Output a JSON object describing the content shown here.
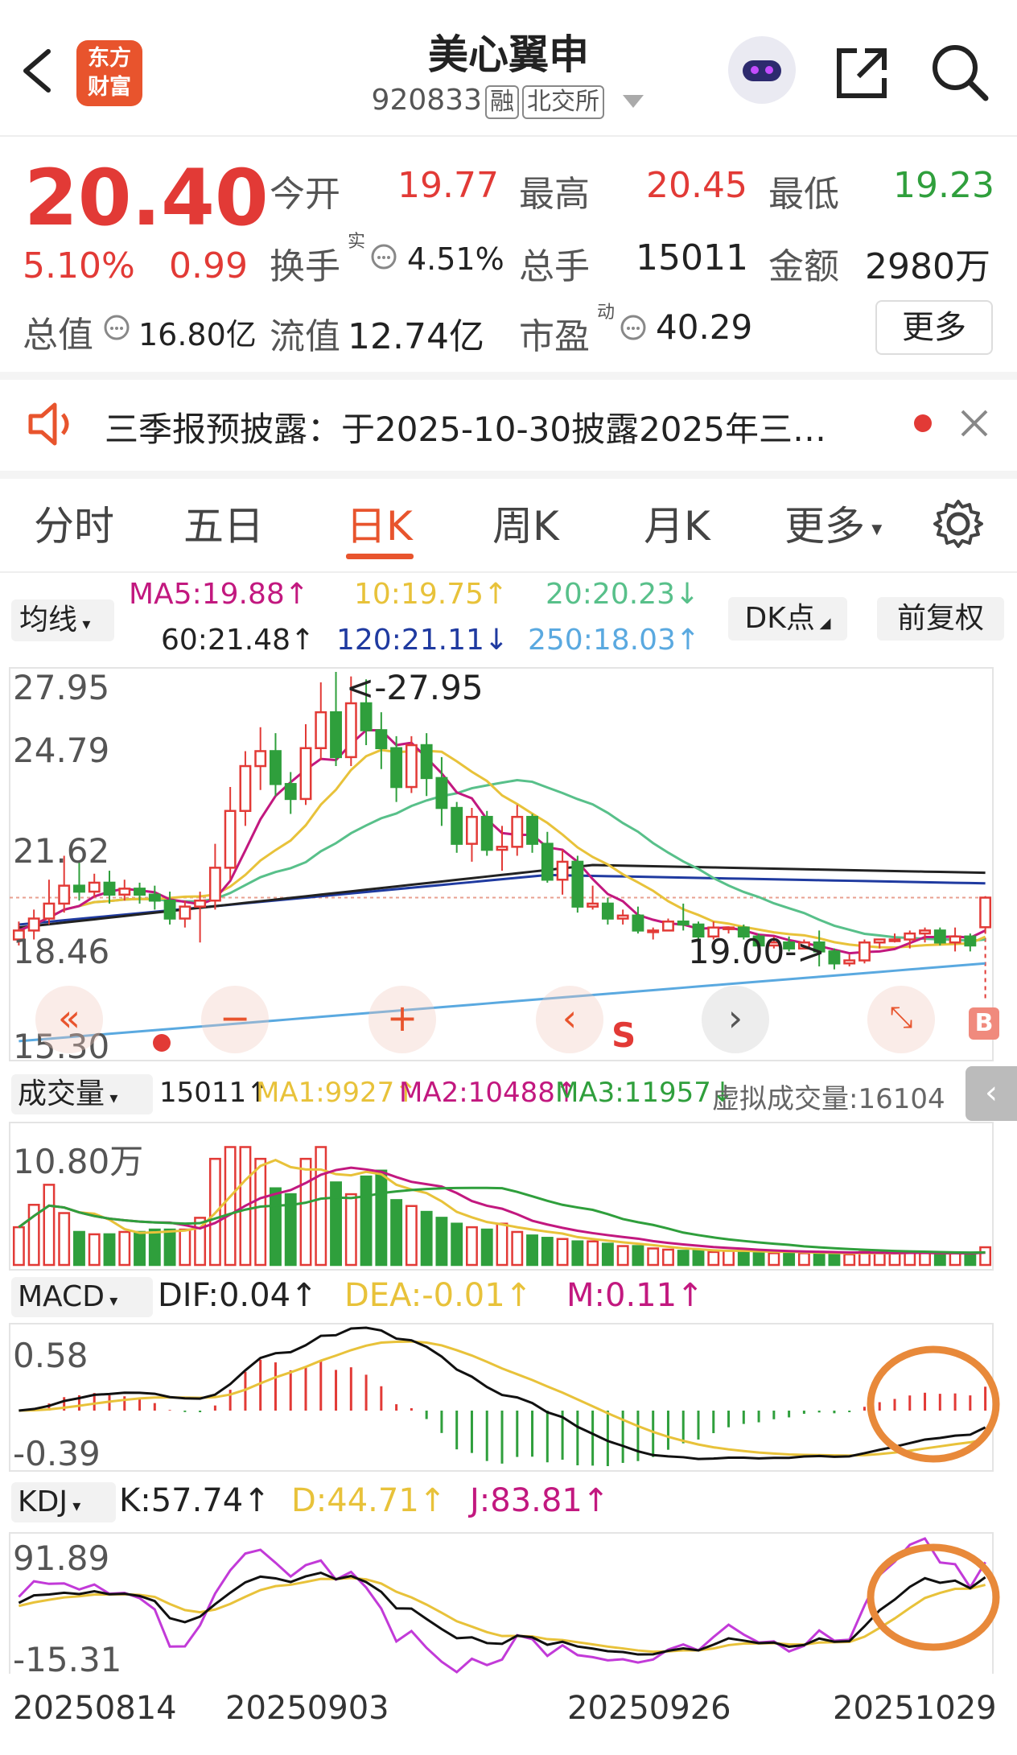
{
  "header": {
    "title": "美心翼申",
    "code": "920833",
    "tag_margin": "融",
    "tag_exchange": "北交所",
    "logo_line1": "东方",
    "logo_line2": "财富"
  },
  "quote": {
    "price": "20.40",
    "change_pct": "5.10%",
    "change_amt": "0.99",
    "open_label": "今开",
    "open": "19.77",
    "high_label": "最高",
    "high": "20.45",
    "low_label": "最低",
    "low": "19.23",
    "turnover_label": "换手",
    "turnover_sup": "实",
    "turnover": "4.51%",
    "volume_label": "总手",
    "volume": "15011",
    "amount_label": "金额",
    "amount": "2980万",
    "mktcap_label": "总值",
    "mktcap": "16.80亿",
    "float_label": "流值",
    "float_cap": "12.74亿",
    "pe_label": "市盈",
    "pe_sup": "动",
    "pe": "40.29",
    "more_label": "更多"
  },
  "notice": {
    "text": "三季报预披露：于2025-10-30披露2025年三…"
  },
  "tabs": [
    "分时",
    "五日",
    "日K",
    "周K",
    "月K",
    "更多"
  ],
  "selected_tab": "日K",
  "kline": {
    "ma_selector": "均线",
    "dk_label": "DK点",
    "adjust_label": "前复权",
    "ma5": "MA5:19.88↑",
    "ma10": "10:19.75↑",
    "ma20": "20:20.23↓",
    "ma60": "60:21.48↑",
    "ma120": "120:21.11↓",
    "ma250": "250:18.03↑",
    "y_labels": [
      "27.95",
      "24.79",
      "21.62",
      "18.46",
      "15.30"
    ],
    "high_note": "<-27.95",
    "low_note": "19.00->",
    "sell_mark": "S",
    "buy_mark": "B"
  },
  "volume_panel": {
    "selector": "成交量",
    "vol": "15011↑",
    "ma1": "MA1:9927↑",
    "ma2": "MA2:10488↑",
    "ma3": "MA3:11957↓",
    "virtual": "虚拟成交量:16104",
    "y_label": "10.80万"
  },
  "macd": {
    "selector": "MACD",
    "dif": "DIF:0.04↑",
    "dea": "DEA:-0.01↑",
    "m": "M:0.11↑",
    "y_top": "0.58",
    "y_bottom": "-0.39"
  },
  "kdj": {
    "selector": "KDJ",
    "k": "K:57.74↑",
    "d": "D:44.71↑",
    "j": "J:83.81↑",
    "y_top": "91.89",
    "y_bottom": "-15.31"
  },
  "dates": [
    "20250814",
    "20250903",
    "20250926",
    "20251029"
  ],
  "colors": {
    "up": "#e23a36",
    "down": "#2f9f3c",
    "accent": "#e8542d",
    "ma5": "#c2187f",
    "ma10": "#e8c23a",
    "ma20": "#58c08a",
    "ma60": "#222222",
    "ma120": "#1f3aa0",
    "ma250": "#5aa9e0"
  },
  "chart_data": {
    "type": "candlestick",
    "dates_shown": [
      "20250814",
      "20250903",
      "20250926",
      "20251029"
    ],
    "candles": [
      [
        19.0,
        19.3,
        18.8,
        19.6
      ],
      [
        19.3,
        19.7,
        19.0,
        20.0
      ],
      [
        19.7,
        20.2,
        19.5,
        21.0
      ],
      [
        20.2,
        20.8,
        19.9,
        21.8
      ],
      [
        20.8,
        20.6,
        20.3,
        21.6
      ],
      [
        20.6,
        20.9,
        20.4,
        21.2
      ],
      [
        20.9,
        20.5,
        20.2,
        21.3
      ],
      [
        20.5,
        20.7,
        20.3,
        21.0
      ],
      [
        20.7,
        20.5,
        20.2,
        20.9
      ],
      [
        20.5,
        20.3,
        20.0,
        20.8
      ],
      [
        20.3,
        19.7,
        19.5,
        20.6
      ],
      [
        19.7,
        20.1,
        19.4,
        20.3
      ],
      [
        20.1,
        20.3,
        18.9,
        20.6
      ],
      [
        20.3,
        21.4,
        20.0,
        22.2
      ],
      [
        21.4,
        23.3,
        21.0,
        24.1
      ],
      [
        23.3,
        24.8,
        22.8,
        25.3
      ],
      [
        24.8,
        25.3,
        24.0,
        26.1
      ],
      [
        25.3,
        24.2,
        23.8,
        25.9
      ],
      [
        24.2,
        23.7,
        23.2,
        24.6
      ],
      [
        23.7,
        25.4,
        23.5,
        26.2
      ],
      [
        25.4,
        26.6,
        25.0,
        27.6
      ],
      [
        26.6,
        25.1,
        24.8,
        27.95
      ],
      [
        25.1,
        26.9,
        24.8,
        27.8
      ],
      [
        26.9,
        26.0,
        25.5,
        27.7
      ],
      [
        26.0,
        25.4,
        24.7,
        26.6
      ],
      [
        25.4,
        24.1,
        23.6,
        25.8
      ],
      [
        24.1,
        25.5,
        23.9,
        25.8
      ],
      [
        25.5,
        24.4,
        23.8,
        25.9
      ],
      [
        24.4,
        23.4,
        22.8,
        25.1
      ],
      [
        23.4,
        22.2,
        21.9,
        23.6
      ],
      [
        22.2,
        23.1,
        21.6,
        23.4
      ],
      [
        23.1,
        22.0,
        21.8,
        23.3
      ],
      [
        22.0,
        22.1,
        21.3,
        22.8
      ],
      [
        22.1,
        23.1,
        21.8,
        23.5
      ],
      [
        23.1,
        22.2,
        21.9,
        23.2
      ],
      [
        22.2,
        21.0,
        20.9,
        22.6
      ],
      [
        21.0,
        21.6,
        20.5,
        22.0
      ],
      [
        21.6,
        20.1,
        19.9,
        21.8
      ],
      [
        20.1,
        20.2,
        20.0,
        20.8
      ],
      [
        20.2,
        19.7,
        19.5,
        20.4
      ],
      [
        19.7,
        19.8,
        19.5,
        20.0
      ],
      [
        19.8,
        19.3,
        19.2,
        20.1
      ],
      [
        19.3,
        19.3,
        19.0,
        19.4
      ],
      [
        19.3,
        19.6,
        19.3,
        19.7
      ],
      [
        19.6,
        19.5,
        19.3,
        20.2
      ],
      [
        19.5,
        19.1,
        18.9,
        19.6
      ],
      [
        19.1,
        19.4,
        19.0,
        19.6
      ],
      [
        19.4,
        19.4,
        19.2,
        19.4
      ],
      [
        19.4,
        19.1,
        19.0,
        19.5
      ],
      [
        19.1,
        18.8,
        18.6,
        19.2
      ],
      [
        18.8,
        18.9,
        18.7,
        19.1
      ],
      [
        18.9,
        18.7,
        18.6,
        19.1
      ],
      [
        18.7,
        18.9,
        18.7,
        19.0
      ],
      [
        18.9,
        18.6,
        18.1,
        19.3
      ],
      [
        18.6,
        18.2,
        18.0,
        18.7
      ],
      [
        18.2,
        18.3,
        18.1,
        18.5
      ],
      [
        18.3,
        18.9,
        18.2,
        19.0
      ],
      [
        18.9,
        19.0,
        18.7,
        19.0
      ],
      [
        19.0,
        19.0,
        18.9,
        19.2
      ],
      [
        19.0,
        19.2,
        18.7,
        19.3
      ],
      [
        19.2,
        19.3,
        18.9,
        19.4
      ],
      [
        19.3,
        18.9,
        18.8,
        19.4
      ],
      [
        18.9,
        19.1,
        18.6,
        19.4
      ],
      [
        19.1,
        18.8,
        18.6,
        19.2
      ],
      [
        19.41,
        20.4,
        19.23,
        20.45
      ]
    ],
    "volumes_wan": [
      3.2,
      5.1,
      6.8,
      4.4,
      2.8,
      2.6,
      2.6,
      2.8,
      2.8,
      3.0,
      3.0,
      3.0,
      4.0,
      9.0,
      10.0,
      10.0,
      9.0,
      6.5,
      6.0,
      9.0,
      10.0,
      7.0,
      6.0,
      7.5,
      8.0,
      5.5,
      5.0,
      4.5,
      4.0,
      3.5,
      3.2,
      3.0,
      3.5,
      2.8,
      2.5,
      2.3,
      2.2,
      2.0,
      2.0,
      1.8,
      1.6,
      1.6,
      1.4,
      1.3,
      1.2,
      1.2,
      1.1,
      1.2,
      1.3,
      1.0,
      1.0,
      1.1,
      1.0,
      1.1,
      0.9,
      0.9,
      1.1,
      1.0,
      1.0,
      1.1,
      1.0,
      0.9,
      1.0,
      0.9,
      1.5
    ],
    "y_range": [
      15.3,
      27.95
    ],
    "volume_y_max": 10.8
  }
}
